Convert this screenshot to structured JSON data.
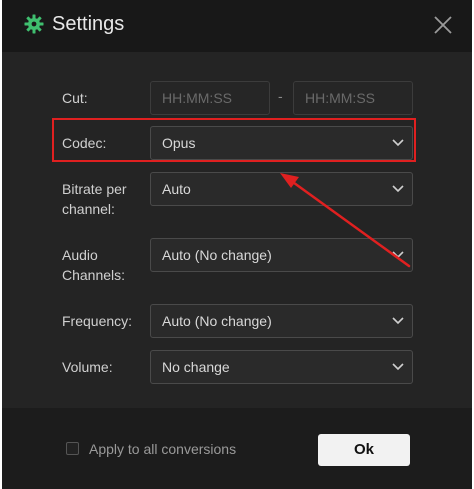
{
  "window": {
    "title": "Settings",
    "icons": {
      "title": "gear-icon",
      "close": "close-icon"
    }
  },
  "form": {
    "cut": {
      "label": "Cut:",
      "start_placeholder": "HH:MM:SS",
      "separator": "-",
      "end_placeholder": "HH:MM:SS"
    },
    "codec": {
      "label": "Codec:",
      "value": "Opus"
    },
    "bitrate": {
      "label_line1": "Bitrate per",
      "label_line2": "channel:",
      "value": "Auto"
    },
    "audio_channels": {
      "label_line1": "Audio",
      "label_line2": "Channels:",
      "value": "Auto (No change)"
    },
    "frequency": {
      "label": "Frequency:",
      "value": "Auto (No change)"
    },
    "volume": {
      "label": "Volume:",
      "value": "No change"
    }
  },
  "footer": {
    "apply_all_label": "Apply to all conversions",
    "apply_all_checked": false,
    "ok_label": "Ok"
  },
  "colors": {
    "accent_icon": "#3fbf6f",
    "annotation": "#e02020",
    "dialog_bg": "#1c1c1c",
    "panel_bg": "#242424"
  }
}
